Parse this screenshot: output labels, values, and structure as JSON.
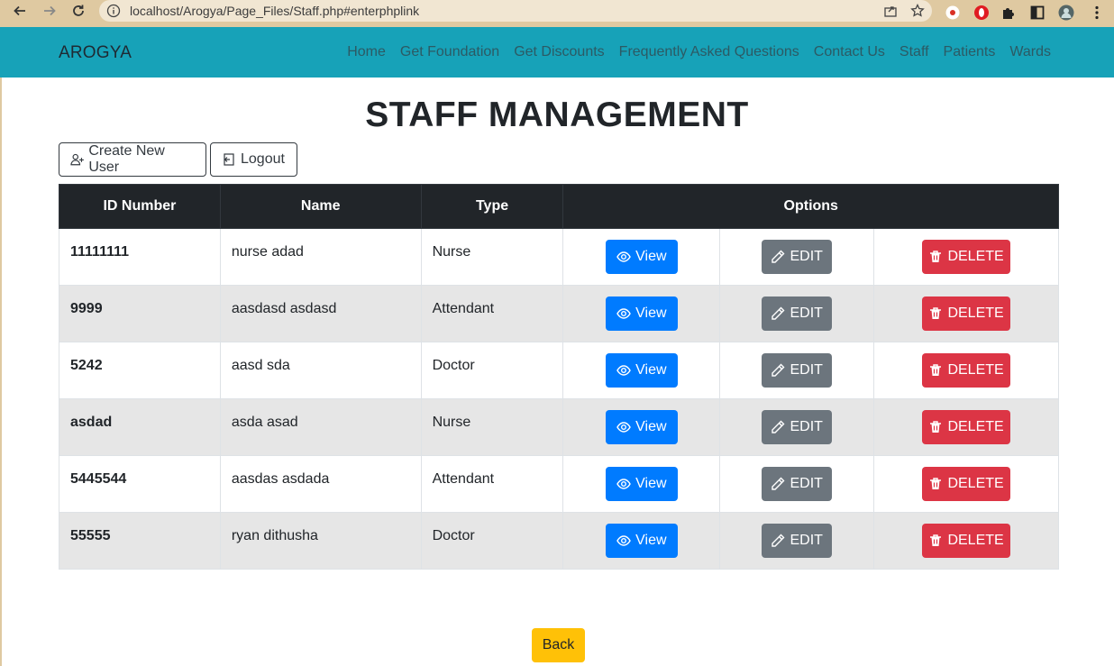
{
  "browser": {
    "url": "localhost/Arogya/Page_Files/Staff.php#enterphplink"
  },
  "navbar": {
    "brand": "AROGYA",
    "links": [
      "Home",
      "Get Foundation",
      "Get Discounts",
      "Frequently Asked Questions",
      "Contact Us",
      "Staff",
      "Patients",
      "Wards"
    ]
  },
  "page": {
    "title": "STAFF MANAGEMENT",
    "create_label": "Create New User",
    "logout_label": "Logout",
    "back_label": "Back"
  },
  "table": {
    "headers": [
      "ID Number",
      "Name",
      "Type",
      "Options"
    ],
    "view_label": "View",
    "edit_label": "EDIT",
    "delete_label": "DELETE",
    "rows": [
      {
        "id": "11111111",
        "name": "nurse adad",
        "type": "Nurse"
      },
      {
        "id": "9999",
        "name": "aasdasd asdasd",
        "type": "Attendant"
      },
      {
        "id": "5242",
        "name": "aasd sda",
        "type": "Doctor"
      },
      {
        "id": "asdad",
        "name": "asda asad",
        "type": "Nurse"
      },
      {
        "id": "5445544",
        "name": "aasdas asdada",
        "type": "Attendant"
      },
      {
        "id": "55555",
        "name": "ryan dithusha",
        "type": "Doctor"
      }
    ]
  },
  "colors": {
    "navbar": "#17a2b8",
    "view": "#007bff",
    "edit": "#6c757d",
    "delete": "#dc3545",
    "back": "#ffc107",
    "header": "#212529"
  }
}
